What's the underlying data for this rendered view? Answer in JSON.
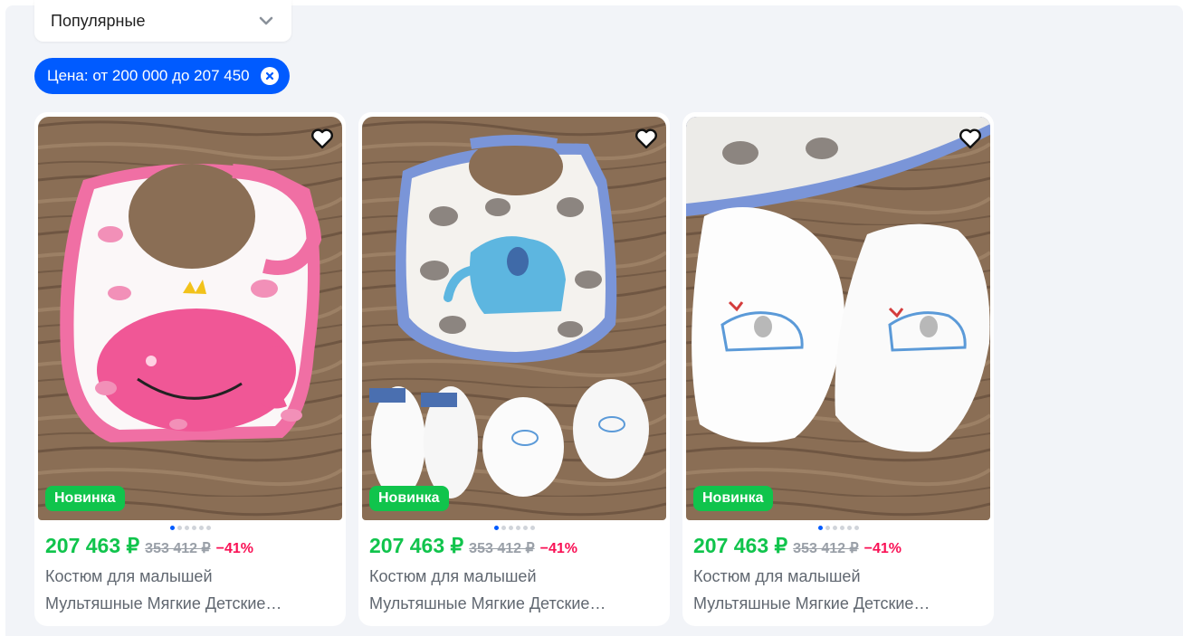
{
  "sort": {
    "selected": "Популярные"
  },
  "filter_chip": {
    "label": "Цена: от 200 000 до 207 450"
  },
  "colors": {
    "accent": "#005bff",
    "price": "#10c44c",
    "discount": "#f91155",
    "badge": "#10c44c"
  },
  "products": [
    {
      "badge": "Новинка",
      "price": "207 463 ₽",
      "old_price": "353 412 ₽",
      "discount": "−41%",
      "title_line1": "Костюм для малышей",
      "title_line2": "Мультяшные Мягкие Детские…",
      "image": "pink-whale-bib",
      "active_dot": 0
    },
    {
      "badge": "Новинка",
      "price": "207 463 ₽",
      "old_price": "353 412 ₽",
      "discount": "−41%",
      "title_line1": "Костюм для малышей",
      "title_line2": "Мультяшные Мягкие Детские…",
      "image": "elephant-bib-socks-mittens",
      "active_dot": 0
    },
    {
      "badge": "Новинка",
      "price": "207 463 ₽",
      "old_price": "353 412 ₽",
      "discount": "−41%",
      "title_line1": "Костюм для малышей",
      "title_line2": "Мультяшные Мягкие Детские…",
      "image": "elephant-mittens",
      "active_dot": 0
    }
  ]
}
